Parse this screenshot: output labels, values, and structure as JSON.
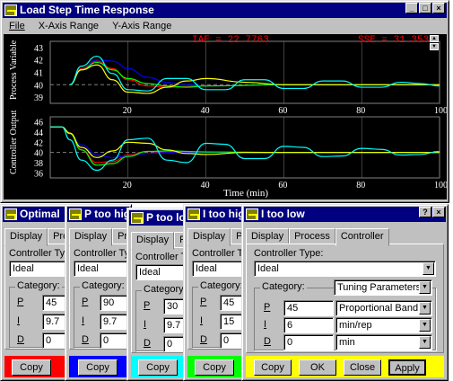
{
  "main_window": {
    "title": "Load Step Time Response",
    "menu": [
      "File",
      "X-Axis Range",
      "Y-Axis Range"
    ],
    "buttons": {
      "minimize": "_",
      "maximize": "□",
      "close": "×"
    }
  },
  "plot": {
    "iae_text": "IAE = 22.7763",
    "sse_text": "SSE = 31.3532",
    "top_ylabel": "Process Variable",
    "bottom_ylabel": "Controller Output",
    "xlabel": "Time (min)",
    "top_yticks": [
      "43",
      "42",
      "41",
      "40",
      "39"
    ],
    "bottom_yticks": [
      "46",
      "44",
      "42",
      "40",
      "38",
      "36"
    ],
    "top_xticks": [
      "20",
      "40",
      "60",
      "80",
      "100"
    ],
    "bottom_xticks": [
      "20",
      "40",
      "60",
      "80",
      "100"
    ],
    "colors": {
      "optimal": "#ff0000",
      "p_high1": "#0000ff",
      "p_high2": "#00ffff",
      "i_high": "#00ff00",
      "p_low": "#ffff00",
      "grid": "#808080",
      "text": "#ffffff",
      "readout": "#ff0000"
    }
  },
  "chart_data": [
    {
      "type": "line",
      "title": "",
      "xlabel": "",
      "ylabel": "Process Variable",
      "xlim": [
        0,
        100
      ],
      "ylim": [
        38.5,
        43.5
      ],
      "series": [
        {
          "color": "#ff0000",
          "x": [
            5,
            8,
            12,
            16,
            20,
            25,
            30,
            40,
            60,
            100
          ],
          "values": [
            40,
            41.3,
            41.9,
            41.3,
            40.4,
            39.9,
            39.8,
            39.9,
            40.0,
            40.0
          ]
        },
        {
          "color": "#0000ff",
          "x": [
            5,
            8,
            12,
            16,
            20,
            25,
            30,
            35,
            40,
            60,
            100
          ],
          "values": [
            40,
            41.2,
            42.0,
            41.9,
            41.3,
            40.6,
            40.2,
            40.0,
            39.9,
            40.0,
            40.0
          ]
        },
        {
          "color": "#00ff00",
          "x": [
            5,
            8,
            12,
            16,
            20,
            25,
            30,
            35,
            40,
            60,
            100
          ],
          "values": [
            40,
            41.2,
            41.8,
            41.2,
            40.5,
            40.1,
            39.9,
            39.8,
            39.9,
            40.0,
            40.0
          ]
        },
        {
          "color": "#ffff00",
          "x": [
            5,
            8,
            12,
            16,
            20,
            25,
            30,
            35,
            40,
            50,
            60,
            100
          ],
          "values": [
            40,
            41.2,
            41.6,
            40.4,
            39.4,
            39.3,
            39.8,
            40.3,
            40.5,
            40.2,
            40.0,
            40.0
          ]
        },
        {
          "color": "#00ffff",
          "x": [
            5,
            8,
            12,
            16,
            20,
            25,
            30,
            35,
            40,
            45,
            50,
            55,
            60,
            65,
            70,
            75,
            80,
            85,
            90,
            95,
            100
          ],
          "values": [
            40,
            41.5,
            42.3,
            40.9,
            39.6,
            39.5,
            40.5,
            40.5,
            39.6,
            39.6,
            40.4,
            40.4,
            39.7,
            39.7,
            40.3,
            40.3,
            39.8,
            39.8,
            40.2,
            40.1,
            39.9
          ]
        }
      ]
    },
    {
      "type": "line",
      "title": "",
      "xlabel": "Time (min)",
      "ylabel": "Controller Output",
      "xlim": [
        0,
        100
      ],
      "ylim": [
        35,
        47
      ],
      "series": [
        {
          "color": "#ff0000",
          "x": [
            0,
            3,
            5,
            8,
            12,
            16,
            20,
            25,
            30,
            40,
            60,
            100
          ],
          "values": [
            45,
            45,
            43.8,
            40.5,
            38.0,
            38.2,
            39.5,
            40.2,
            40.0,
            40.0,
            40.0,
            40.0
          ]
        },
        {
          "color": "#0000ff",
          "x": [
            0,
            3,
            5,
            8,
            12,
            16,
            20,
            25,
            30,
            40,
            60,
            100
          ],
          "values": [
            45,
            45,
            43.7,
            41.5,
            39.5,
            39.0,
            39.3,
            39.8,
            40.0,
            40.0,
            40.0,
            40.0
          ]
        },
        {
          "color": "#00ff00",
          "x": [
            0,
            3,
            5,
            8,
            12,
            16,
            20,
            25,
            30,
            40,
            60,
            100
          ],
          "values": [
            45,
            45,
            43.7,
            40.5,
            37.5,
            37.8,
            39.2,
            40.2,
            40.3,
            40.1,
            40.0,
            40.0
          ]
        },
        {
          "color": "#ffff00",
          "x": [
            0,
            3,
            5,
            8,
            12,
            16,
            20,
            25,
            30,
            35,
            40,
            50,
            60,
            100
          ],
          "values": [
            45,
            45,
            43.8,
            41.0,
            39.0,
            40.3,
            42.0,
            41.8,
            40.5,
            39.8,
            39.6,
            40.0,
            40.0,
            40.0
          ]
        },
        {
          "color": "#00ffff",
          "x": [
            0,
            3,
            5,
            8,
            12,
            16,
            20,
            25,
            30,
            35,
            40,
            45,
            50,
            55,
            60,
            65,
            70,
            75,
            80,
            85,
            90,
            95,
            100
          ],
          "values": [
            45,
            45,
            42.5,
            38.5,
            36.5,
            38.5,
            42.5,
            42.8,
            38.5,
            38.0,
            41.8,
            41.6,
            38.8,
            38.8,
            41.2,
            41.0,
            39.2,
            39.3,
            40.8,
            40.6,
            39.5,
            39.6,
            40.2
          ]
        }
      ]
    }
  ],
  "dialogs": [
    {
      "title": "Optimal",
      "tab1": "Display",
      "tab2": "Proc",
      "ctype_label": "Controller Ty",
      "ctype_value": "Ideal",
      "category": "Category:",
      "p_label": "P",
      "p_value": "45",
      "i_label": "I",
      "i_value": "9.7",
      "d_label": "D",
      "d_value": "0",
      "copy": "Copy",
      "bar_color": "#ff0000"
    },
    {
      "title": "P too high",
      "tab1": "Display",
      "tab2": "Pro",
      "ctype_label": "Controller Ty",
      "ctype_value": "Ideal",
      "category": "Category:",
      "p_label": "P",
      "p_value": "90",
      "i_label": "I",
      "i_value": "9.7",
      "d_label": "D",
      "d_value": "0",
      "copy": "Copy",
      "bar_color": "#0000ff"
    },
    {
      "title": "P too low",
      "tab1": "Display",
      "tab2": "Pro",
      "ctype_label": "Controller T",
      "ctype_value": "Ideal",
      "category": "Category:",
      "p_label": "P",
      "p_value": "30",
      "i_label": "I",
      "i_value": "9.7",
      "d_label": "D",
      "d_value": "0",
      "copy": "Copy",
      "bar_color": "#00ffff"
    },
    {
      "title": "I too high",
      "tab1": "Display",
      "tab2": "Pro",
      "ctype_label": "Controller T",
      "ctype_value": "Ideal",
      "category": "Category:",
      "p_label": "P",
      "p_value": "45",
      "i_label": "I",
      "i_value": "15",
      "d_label": "D",
      "d_value": "0",
      "copy": "Copy",
      "bar_color": "#00ff00"
    }
  ],
  "front_dialog": {
    "title": "I too low",
    "help_btn": "?",
    "close_btn": "×",
    "tabs": [
      "Display",
      "Process",
      "Controller"
    ],
    "ctype_label": "Controller Type:",
    "ctype_value": "Ideal",
    "category_label": "Category:",
    "category_value": "Tuning Parameters",
    "p_label": "P",
    "p_value": "45",
    "p_unit": "Proportional Band",
    "i_label": "I",
    "i_value": "6",
    "i_unit": "min/rep",
    "d_label": "D",
    "d_value": "0",
    "d_unit": "min",
    "buttons": [
      "Copy",
      "OK",
      "Close",
      "Apply"
    ],
    "bar_color": "#ffff00"
  }
}
